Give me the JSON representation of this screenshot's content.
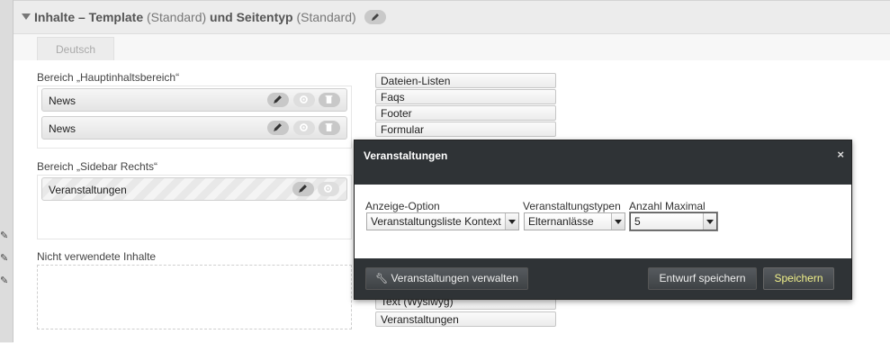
{
  "header": {
    "title_bold_1": "Inhalte – Template",
    "title_light_1": "(Standard)",
    "title_bold_2": "und Seitentyp",
    "title_light_2": "(Standard)"
  },
  "tab": {
    "label": "Deutsch"
  },
  "areas": {
    "main": {
      "label": "Bereich „Hauptinhaltsbereich“",
      "items": [
        "News",
        "News"
      ]
    },
    "sidebar": {
      "label": "Bereich „Sidebar Rechts“",
      "items": [
        "Veranstaltungen"
      ]
    },
    "unused": {
      "label": "Nicht verwendete Inhalte"
    }
  },
  "content_list": [
    "Dateien-Listen",
    "Faqs",
    "Footer",
    "Formular",
    "Text (Wysiwyg)",
    "Veranstaltungen"
  ],
  "modal": {
    "title": "Veranstaltungen",
    "close": "×",
    "fields": {
      "display_option": {
        "label": "Anzeige-Option",
        "value": "Veranstaltungsliste Kontext"
      },
      "event_types": {
        "label": "Veranstaltungstypen",
        "value": "Elternanlässe"
      },
      "max_count": {
        "label": "Anzahl Maximal",
        "value": "5"
      }
    },
    "buttons": {
      "manage": "Veranstaltungen verwalten",
      "draft": "Entwurf speichern",
      "save": "Speichern"
    }
  }
}
